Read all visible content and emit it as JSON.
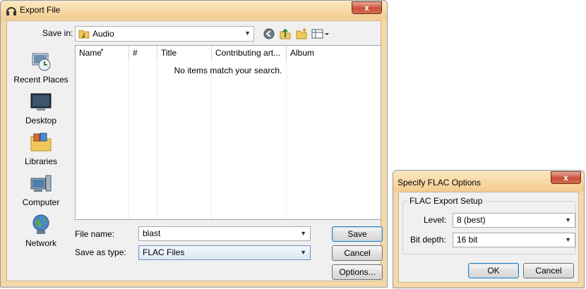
{
  "export_dialog": {
    "title": "Export File",
    "close_label": "x",
    "save_in": {
      "label": "Save in:",
      "value": "Audio"
    },
    "places": [
      {
        "label": "Recent Places"
      },
      {
        "label": "Desktop"
      },
      {
        "label": "Libraries"
      },
      {
        "label": "Computer"
      },
      {
        "label": "Network"
      }
    ],
    "columns": [
      "Name",
      "#",
      "Title",
      "Contributing art...",
      "Album"
    ],
    "empty_message": "No items match your search.",
    "file_name": {
      "label": "File name:",
      "value": "blast"
    },
    "save_as_type": {
      "label": "Save as type:",
      "value": "FLAC Files"
    },
    "buttons": {
      "save": "Save",
      "cancel": "Cancel",
      "options": "Options..."
    }
  },
  "flac_dialog": {
    "title": "Specify FLAC Options",
    "close_label": "x",
    "group_title": "FLAC Export Setup",
    "level": {
      "label": "Level:",
      "value": "8 (best)"
    },
    "bit_depth": {
      "label": "Bit depth:",
      "value": "16 bit"
    },
    "buttons": {
      "ok": "OK",
      "cancel": "Cancel"
    }
  },
  "colors": {
    "frame": "#f6d7a6",
    "titlebar_top": "#fde9c2",
    "close_red": "#c9503a",
    "client_bg": "#f0f0f0",
    "default_button_border": "#3c7fb1"
  }
}
